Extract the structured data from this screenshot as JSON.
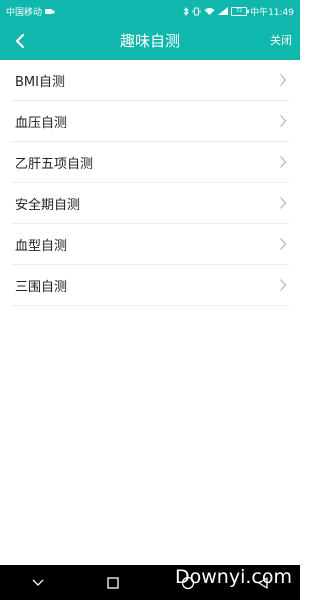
{
  "status_bar": {
    "carrier": "中国移动",
    "battery": "72",
    "time": "中午11:49"
  },
  "header": {
    "title": "趣味自测",
    "close_label": "关闭",
    "background": "#10b7ad"
  },
  "menu": {
    "items": [
      {
        "label": "BMI自测"
      },
      {
        "label": "血压自测"
      },
      {
        "label": "乙肝五项自测"
      },
      {
        "label": "安全期自测"
      },
      {
        "label": "血型自测"
      },
      {
        "label": "三围自测"
      }
    ]
  },
  "navigation_bar": {
    "buttons": [
      "chevron-down-icon",
      "square-icon",
      "circle-icon",
      "triangle-back-icon"
    ]
  },
  "watermark": {
    "text": "Downyi.com"
  }
}
